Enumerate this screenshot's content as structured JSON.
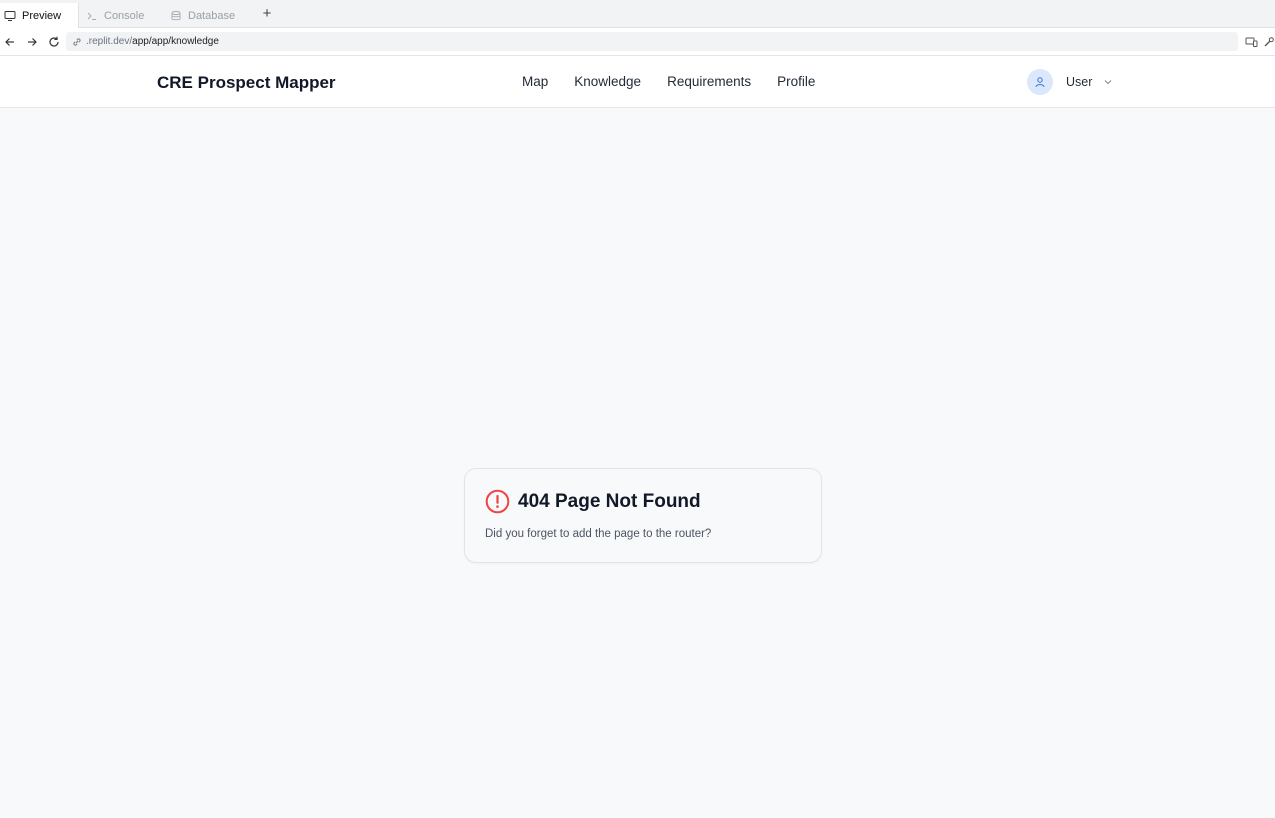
{
  "browser": {
    "tabs": [
      {
        "label": "Preview",
        "icon": "monitor-icon",
        "active": true
      },
      {
        "label": "Console",
        "icon": "terminal-icon",
        "active": false
      },
      {
        "label": "Database",
        "icon": "database-icon",
        "active": false
      }
    ],
    "new_tab_label": "+",
    "url_host": ".replit.dev/",
    "url_path": "app/app/knowledge"
  },
  "header": {
    "brand": "CRE Prospect Mapper",
    "nav": [
      "Map",
      "Knowledge",
      "Requirements",
      "Profile"
    ],
    "user_label": "User"
  },
  "error": {
    "title": "404 Page Not Found",
    "message": "Did you forget to add the page to the router?",
    "icon": "alert-circle-icon",
    "accent_color": "#ef4444"
  }
}
